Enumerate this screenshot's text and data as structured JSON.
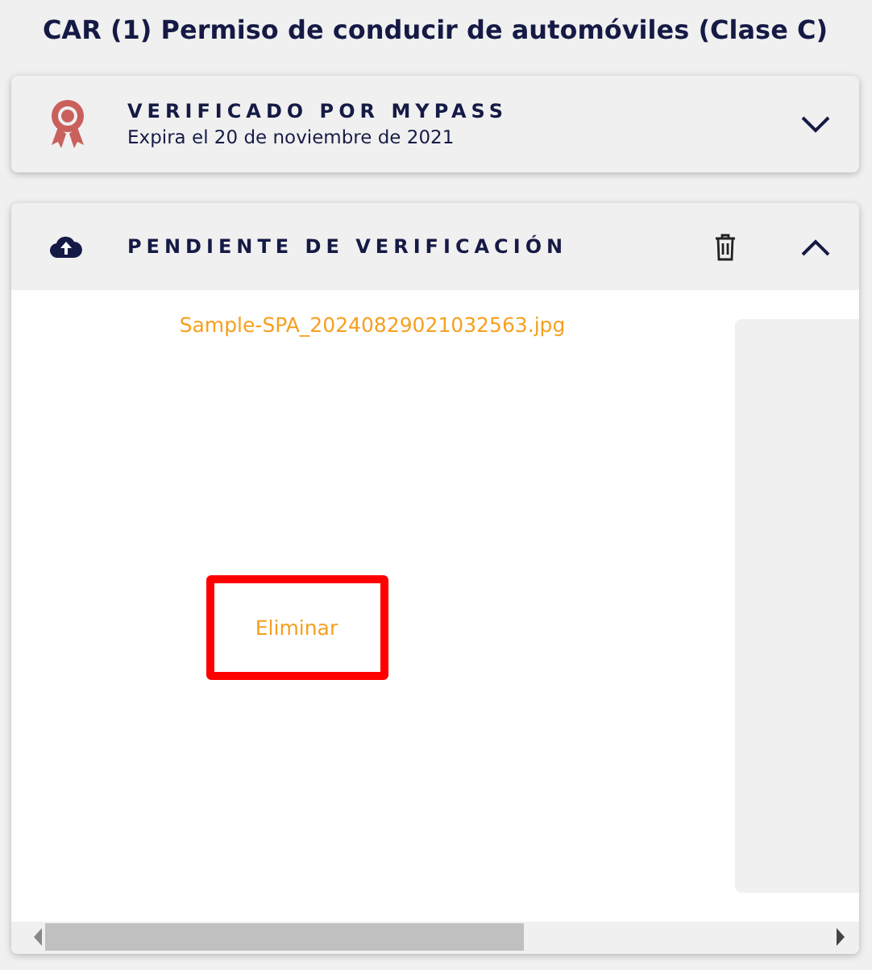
{
  "title": "CAR (1) Permiso de conducir de automóviles (Clase C)",
  "sections": [
    {
      "kind": "verified",
      "heading": "VERIFICADO POR MYPASS",
      "subtitle": "Expira el 20 de noviembre de 2021",
      "expanded": false
    },
    {
      "kind": "pending",
      "heading": "PENDIENTE DE VERIFICACIÓN",
      "expanded": true,
      "file": {
        "name": "Sample-SPA_20240829021032563.jpg",
        "action": "Eliminar",
        "highlighted": true
      }
    }
  ]
}
